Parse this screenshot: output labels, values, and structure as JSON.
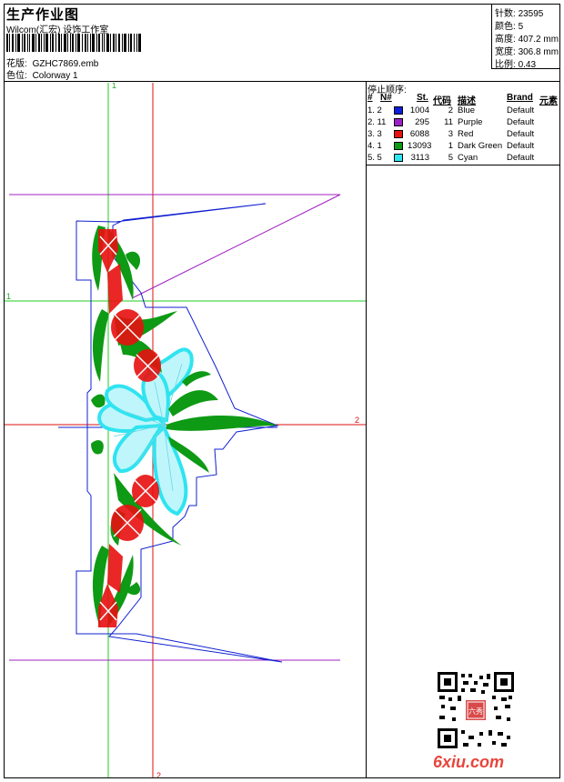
{
  "header": {
    "title": "生产作业图",
    "subtitle": "Wilcom(汇宏) 设饰工作室",
    "pattern_label": "花版:",
    "pattern_value": "GZHC7869.emb",
    "colorway_label": "色位:",
    "colorway_value": "Colorway 1"
  },
  "stats": [
    {
      "label": "针数:",
      "value": "23595"
    },
    {
      "label": "颜色:",
      "value": "5"
    },
    {
      "label": "高度:",
      "value": "407.2 mm"
    },
    {
      "label": "宽度:",
      "value": "306.8 mm"
    },
    {
      "label": "比例:",
      "value": "0.43"
    }
  ],
  "stop_sequence": {
    "title": "停止顺序:",
    "headers": {
      "hash": "#",
      "no": "N#",
      "st": "St.",
      "code": "代码",
      "desc": "描述",
      "brand": "Brand",
      "element": "元素"
    },
    "rows": [
      {
        "order": "1. 2",
        "color": "#0b1fdc",
        "stitches": "1004",
        "code": "2",
        "desc": "Blue",
        "brand": "Default"
      },
      {
        "order": "2. 11",
        "color": "#9b20c8",
        "stitches": "295",
        "code": "11",
        "desc": "Purple",
        "brand": "Default"
      },
      {
        "order": "3. 3",
        "color": "#e81010",
        "stitches": "6088",
        "code": "3",
        "desc": "Red",
        "brand": "Default"
      },
      {
        "order": "4. 1",
        "color": "#0e9a14",
        "stitches": "13093",
        "code": "1",
        "desc": "Dark Green",
        "brand": "Default"
      },
      {
        "order": "5. 5",
        "color": "#2ee6f2",
        "stitches": "3113",
        "code": "5",
        "desc": "Cyan",
        "brand": "Default"
      }
    ]
  },
  "guides": {
    "v1": "1",
    "v2": "2",
    "h1": "1",
    "h2": "2"
  },
  "watermark": {
    "text": "6xiu.com",
    "seal": "六秀"
  }
}
